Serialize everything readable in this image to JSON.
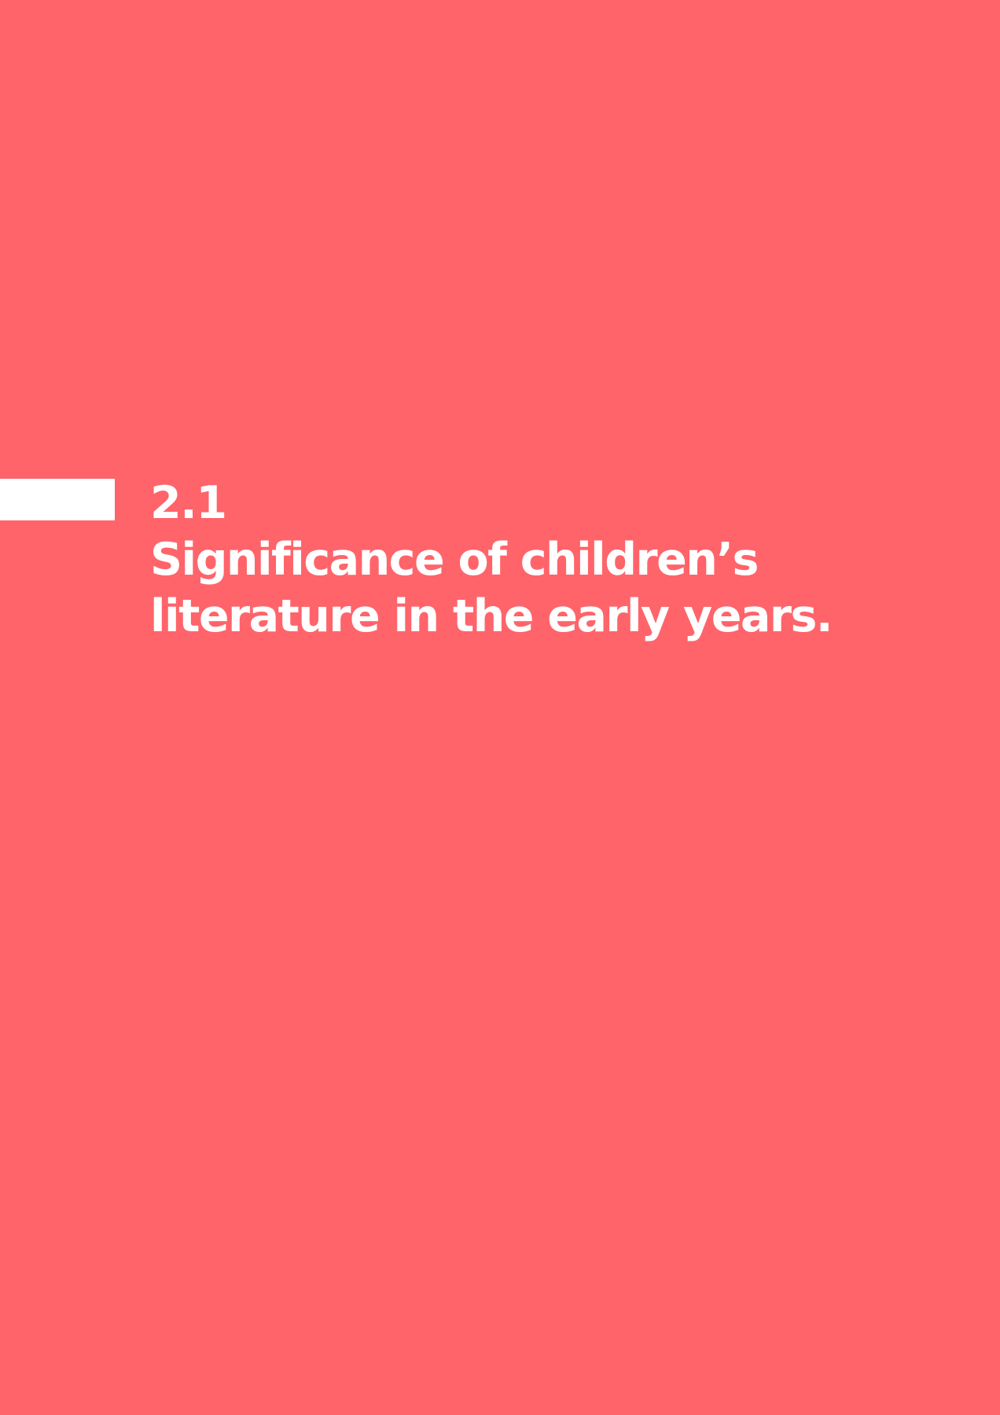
{
  "section": {
    "number": "2.1",
    "title_line_1": "Significance of children’s",
    "title_line_2": "literature in the early years."
  },
  "colors": {
    "background": "#FF646B",
    "text": "#FFFFFF",
    "accent_bar": "#FFFFFF"
  }
}
